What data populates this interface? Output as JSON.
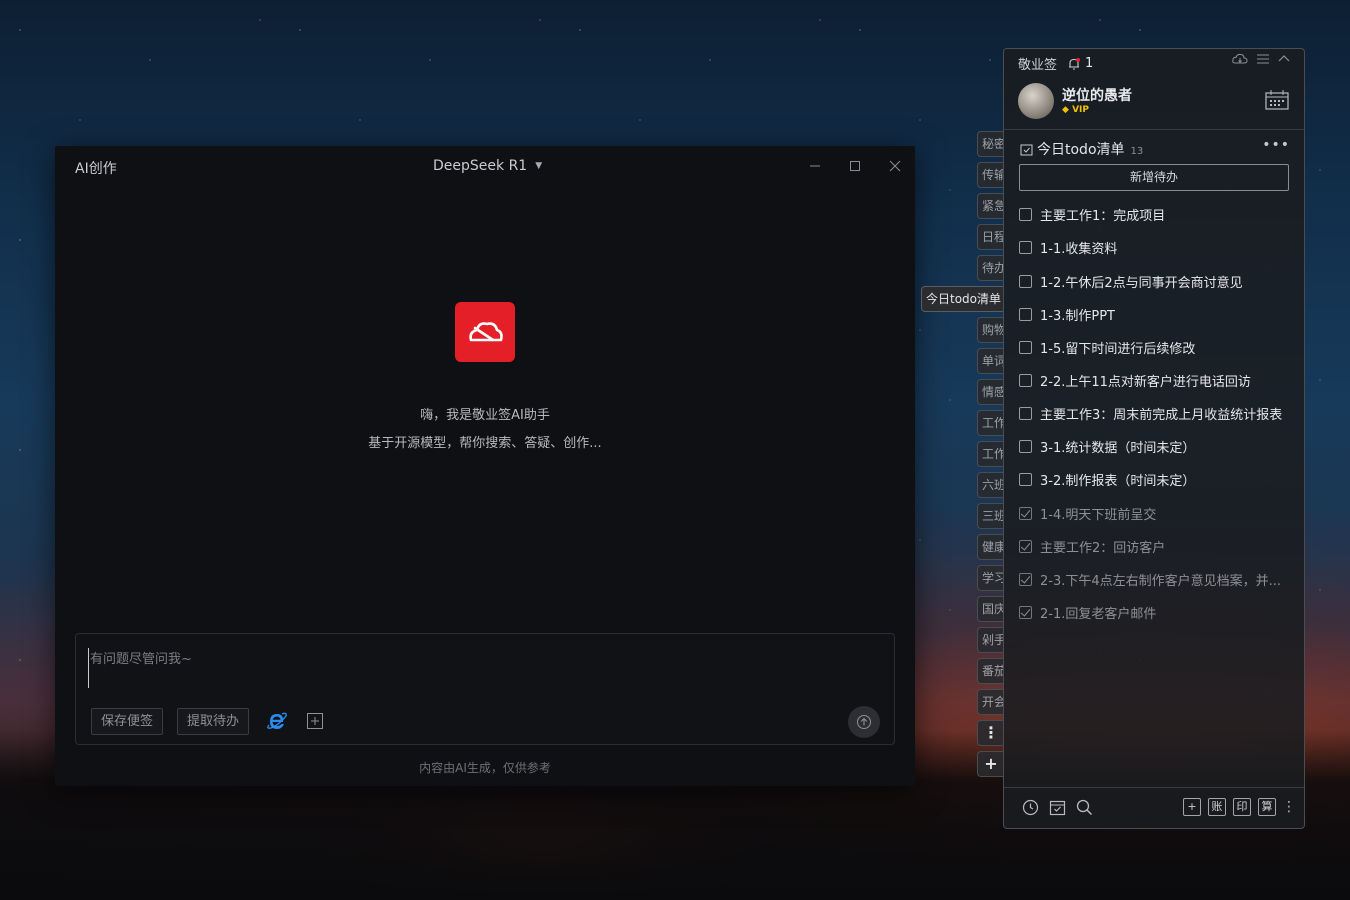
{
  "ai_window": {
    "title": "AI创作",
    "model": "DeepSeek R1",
    "greeting": "嗨，我是敬业签AI助手",
    "subtitle": "基于开源模型，帮你搜索、答疑、创作...",
    "input_placeholder": "有问题尽管问我~",
    "save_note_label": "保存便签",
    "extract_todo_label": "提取待办",
    "disclaimer": "内容由AI生成，仅供参考"
  },
  "side_tabs": [
    "秘密",
    "传输",
    "紧急",
    "日程",
    "待办",
    "今日todo清单",
    "购物",
    "单词",
    "情感",
    "工作",
    "工作",
    "六班",
    "三班",
    "健康",
    "学习",
    "国庆",
    "剁手",
    "番茄",
    "开会"
  ],
  "panel": {
    "app_name": "敬业签",
    "reminder_count": "1",
    "user_name": "逆位的愚者",
    "vip_label": "VIP",
    "list_title": "今日todo清单",
    "list_count": "13",
    "add_button": "新增待办",
    "todos": [
      {
        "text": "主要工作1：完成项目",
        "done": false
      },
      {
        "text": "1-1.收集资料",
        "done": false
      },
      {
        "text": "1-2.午休后2点与同事开会商讨意见",
        "done": false
      },
      {
        "text": "1-3.制作PPT",
        "done": false
      },
      {
        "text": "1-5.留下时间进行后续修改",
        "done": false
      },
      {
        "text": "2-2.上午11点对新客户进行电话回访",
        "done": false
      },
      {
        "text": "主要工作3：周末前完成上月收益统计报表",
        "done": false
      },
      {
        "text": "3-1.统计数据（时间未定）",
        "done": false
      },
      {
        "text": "3-2.制作报表（时间未定）",
        "done": false
      },
      {
        "text": "1-4.明天下班前呈交",
        "done": true
      },
      {
        "text": "主要工作2：回访客户",
        "done": true
      },
      {
        "text": "2-3.下午4点左右制作客户意见档案，并...",
        "done": true
      },
      {
        "text": "2-1.回复老客户邮件",
        "done": true
      }
    ],
    "bottom_boxes": [
      "+",
      "账",
      "印",
      "算"
    ]
  },
  "colors": {
    "logo_red": "#e51f28",
    "vip_gold": "#f2c200"
  }
}
